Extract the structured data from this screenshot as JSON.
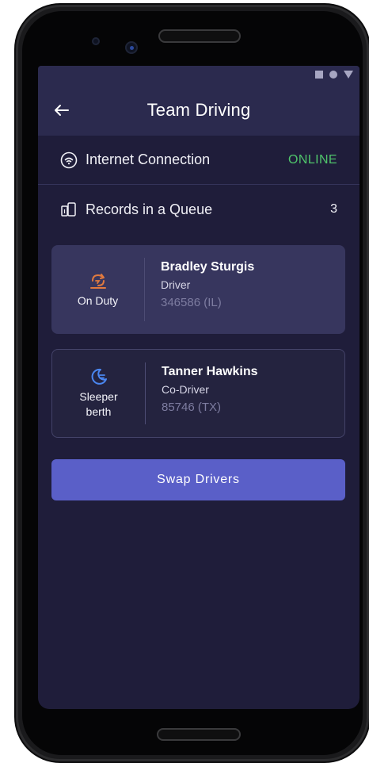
{
  "app": {
    "title": "Team Driving"
  },
  "connection": {
    "label": "Internet Connection",
    "status": "ONLINE",
    "status_color": "#4fc46b"
  },
  "queue": {
    "label": "Records in a Queue",
    "count": "3"
  },
  "drivers": [
    {
      "status_icon": "on-duty-icon",
      "status_label": "On Duty",
      "status_color": "#e07a3f",
      "name": "Bradley Sturgis",
      "role": "Driver",
      "license": "346586 (IL)"
    },
    {
      "status_icon": "sleeper-berth-icon",
      "status_label_line1": "Sleeper",
      "status_label_line2": "berth",
      "status_color": "#4a86f0",
      "name": "Tanner Hawkins",
      "role": "Co-Driver",
      "license": "85746 (TX)"
    }
  ],
  "actions": {
    "swap_label": "Swap Drivers"
  },
  "colors": {
    "background": "#1f1d3a",
    "header": "#2b2a4e",
    "accent_button": "#5a5fc8"
  }
}
